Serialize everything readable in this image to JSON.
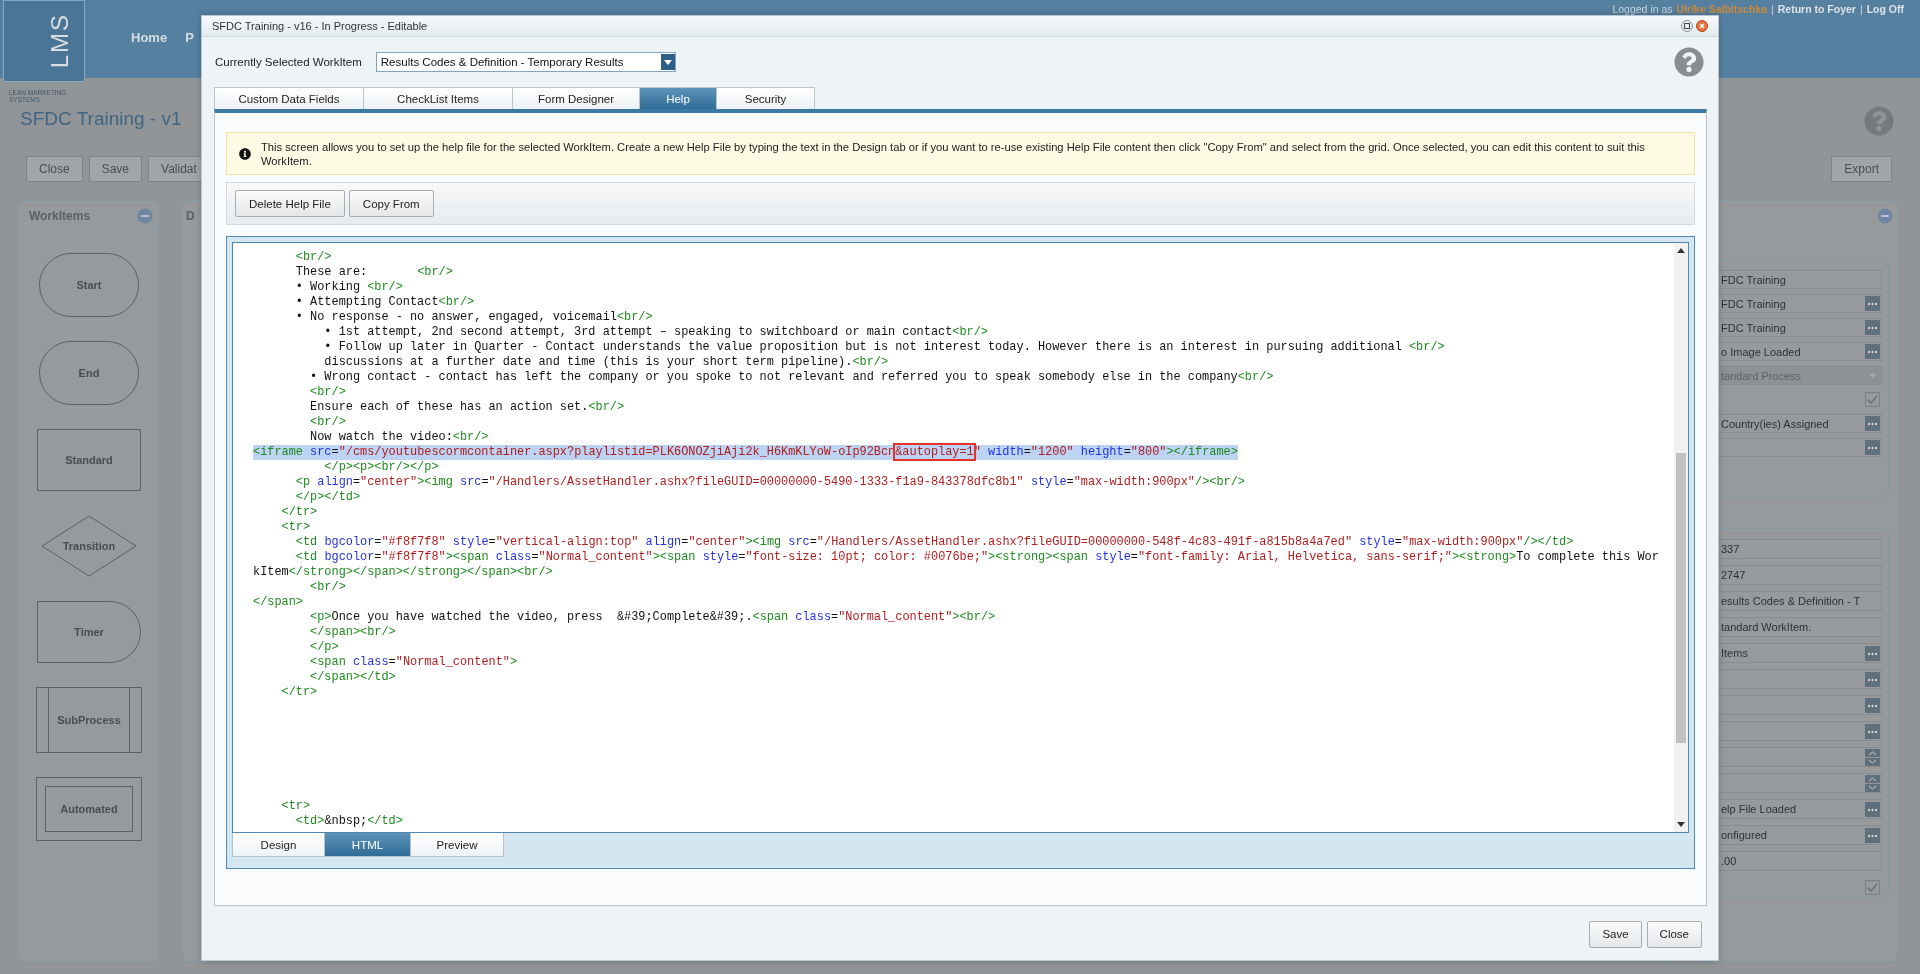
{
  "app": {
    "logo": "LMS",
    "logo_caption": "LEAN MARKETING SYSTEMS",
    "nav": [
      "Home",
      "P"
    ],
    "user_bar": {
      "prefix": "Logged in as",
      "user": "Ulrike Salbitschka",
      "separator": "|",
      "links": [
        "Return to Foyer",
        "Log Off"
      ]
    },
    "title": "SFDC Training - v1",
    "toolbar": [
      "Close",
      "Save",
      "Validat"
    ],
    "export": "Export",
    "workitems": {
      "title": "WorkItems",
      "shapes": [
        {
          "kind": "start",
          "label": "Start"
        },
        {
          "kind": "end",
          "label": "End"
        },
        {
          "kind": "standard",
          "label": "Standard"
        },
        {
          "kind": "transition",
          "label": "Transition"
        },
        {
          "kind": "timer",
          "label": "Timer"
        },
        {
          "kind": "subprocess",
          "label": "SubProcess"
        },
        {
          "kind": "automated",
          "label": "Automated"
        }
      ]
    },
    "designer": {
      "title": "D"
    },
    "properties": {
      "groups": [
        [
          {
            "kind": "text",
            "value": "FDC Training"
          },
          {
            "kind": "picker",
            "value": "FDC Training"
          },
          {
            "kind": "picker",
            "value": "FDC Training"
          },
          {
            "kind": "picker",
            "value": "o Image Loaded"
          },
          {
            "kind": "select",
            "value": "tandard Process",
            "disabled": true
          },
          {
            "kind": "check",
            "checked": true
          },
          {
            "kind": "picker",
            "value": "Country(ies) Assigned"
          },
          {
            "kind": "picker"
          }
        ],
        [
          {
            "kind": "text",
            "value": "337"
          },
          {
            "kind": "text",
            "value": "2747"
          },
          {
            "kind": "text",
            "value": "esults Codes & Definition - T"
          },
          {
            "kind": "text",
            "value": "tandard WorkItem."
          },
          {
            "kind": "picker",
            "value": "Items"
          },
          {
            "kind": "picker"
          },
          {
            "kind": "picker"
          },
          {
            "kind": "picker"
          },
          {
            "kind": "spinner"
          },
          {
            "kind": "spinner"
          },
          {
            "kind": "picker",
            "value": "elp File Loaded"
          },
          {
            "kind": "picker",
            "value": "onfigured"
          },
          {
            "kind": "text",
            "value": ".00"
          },
          {
            "kind": "check",
            "checked": true
          }
        ]
      ]
    }
  },
  "dialog": {
    "title": "SFDC Training - v16 - In Progress - Editable",
    "selector": {
      "label": "Currently Selected WorkItem",
      "value": "Results Codes & Definition - Temporary Results"
    },
    "tabs": [
      {
        "label": "Custom Data Fields",
        "selected": false
      },
      {
        "label": "CheckList Items",
        "selected": false
      },
      {
        "label": "Form Designer",
        "selected": false
      },
      {
        "label": "Help",
        "selected": true
      },
      {
        "label": "Security",
        "selected": false
      }
    ],
    "info": "This screen allows you to set up the help file for the selected WorkItem. Create a new Help File by typing the text in the Design tab or if you want to re-use existing Help File content then click \"Copy From\" and select from the grid. Once selected, you can edit this content to suit this WorkItem.",
    "actions": [
      "Delete Help File",
      "Copy From"
    ],
    "editor": {
      "lines": [
        {
          "text": "      <br/>",
          "highlighted": false
        },
        {
          "text": "      These are:       <br/>",
          "highlighted": false
        },
        {
          "text": "      • Working <br/>",
          "highlighted": false
        },
        {
          "text": "      • Attempting Contact<br/>",
          "highlighted": false
        },
        {
          "text": "      • No response - no answer, engaged, voicemail<br/>",
          "highlighted": false
        },
        {
          "text": "          • 1st attempt, 2nd second attempt, 3rd attempt – speaking to switchboard or main contact<br/>",
          "highlighted": false
        },
        {
          "text": "          • Follow up later in Quarter - Contact understands the value proposition but is not interest today. However there is an interest in pursuing additional <br/>",
          "highlighted": false
        },
        {
          "text": "          discussions at a further date and time (this is your short term pipeline).<br/>",
          "highlighted": false
        },
        {
          "text": "        • Wrong contact - contact has left the company or you spoke to not relevant and referred you to speak somebody else in the company<br/>",
          "highlighted": false
        },
        {
          "text": "        <br/>",
          "highlighted": false
        },
        {
          "text": "        Ensure each of these has an action set.<br/>",
          "highlighted": false
        },
        {
          "text": "        <br/>",
          "highlighted": false
        },
        {
          "text": "        Now watch the video:<br/>",
          "highlighted": false
        },
        {
          "highlighted": true,
          "parts": [
            {
              "text": "<iframe src=\"/cms/youtubescormcontainer.aspx?playlistid=PLK6ONOZjiAji2k_H6KmKLYoW-oIp92Bcn",
              "boxed": false
            },
            {
              "text": "&autoplay=1",
              "boxed": true
            },
            {
              "text": "\" width=\"1200\" height=\"800\"></iframe>",
              "boxed": false
            }
          ]
        },
        {
          "text": "          </p><p><br/></p>",
          "highlighted": false
        },
        {
          "text": "      <p align=\"center\"><img src=\"/Handlers/AssetHandler.ashx?fileGUID=00000000-5490-1333-f1a9-843378dfc8b1\" style=\"max-width:900px\"/><br/>",
          "highlighted": false
        },
        {
          "text": "      </p></td>",
          "highlighted": false
        },
        {
          "text": "    </tr>",
          "highlighted": false
        },
        {
          "text": "    <tr>",
          "highlighted": false
        },
        {
          "text": "      <td bgcolor=\"#f8f7f8\" style=\"vertical-align:top\" align=\"center\"><img src=\"/Handlers/AssetHandler.ashx?fileGUID=00000000-548f-4c83-491f-a815b8a4a7ed\" style=\"max-width:900px\"/></td>",
          "highlighted": false
        },
        {
          "text": "      <td bgcolor=\"#f8f7f8\"><span class=\"Normal_content\"><span style=\"font-size: 10pt; color: #0076be;\"><strong><span style=\"font-family: Arial, Helvetica, sans-serif;\"><strong>To complete this Wor",
          "highlighted": false
        },
        {
          "text": "kItem</strong></span></strong></span><br/>",
          "highlighted": false
        },
        {
          "text": "        <br/>",
          "highlighted": false
        },
        {
          "text": "</span>",
          "highlighted": false
        },
        {
          "text": "        <p>Once you have watched the video, press  &#39;Complete&#39;.<span class=\"Normal_content\"><br/>",
          "highlighted": false
        },
        {
          "text": "        </span><br/>",
          "highlighted": false
        },
        {
          "text": "        </p>",
          "highlighted": false
        },
        {
          "text": "        <span class=\"Normal_content\">",
          "highlighted": false
        },
        {
          "text": "        </span></td>",
          "highlighted": false
        },
        {
          "text": "    </tr>",
          "highlighted": false
        }
      ],
      "bottom_lines": [
        {
          "text": "    <tr>",
          "highlighted": false
        },
        {
          "text": "      <td>&nbsp;</td>",
          "highlighted": false
        }
      ],
      "modes": [
        {
          "label": "Design",
          "selected": false
        },
        {
          "label": "HTML",
          "selected": true
        },
        {
          "label": "Preview",
          "selected": false
        }
      ]
    },
    "footer": [
      "Save",
      "Close"
    ]
  }
}
